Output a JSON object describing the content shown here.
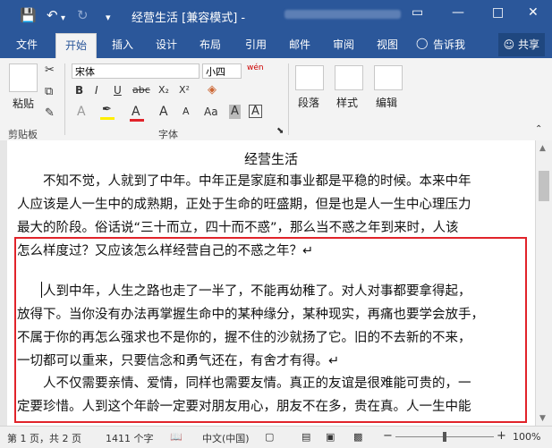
{
  "titlebar": {
    "save_icon": "save-icon",
    "undo_icon": "undo-icon",
    "redo_icon": "redo-icon",
    "title": "经营生活 [兼容模式] -",
    "minimize": "—",
    "restore": "□",
    "close": "✕"
  },
  "tabs": {
    "file": "文件",
    "home": "开始",
    "insert": "插入",
    "design": "设计",
    "layout": "布局",
    "references": "引用",
    "mailings": "邮件",
    "review": "审阅",
    "view": "视图",
    "tell_me": "告诉我",
    "share": "共享"
  },
  "ribbon": {
    "paste": "粘贴",
    "clipboard": "剪贴板",
    "font_name": "宋体",
    "font_size": "小四",
    "wen": "wén",
    "font_group": "字体",
    "bold": "B",
    "italic": "I",
    "underline": "U",
    "strike": "abc",
    "subscript": "X₂",
    "superscript": "X²",
    "font_a": "A",
    "grow_a": "A",
    "shrink_a": "A",
    "case_a": "Aa",
    "boxed_a": "A",
    "paragraph": "段落",
    "styles": "样式",
    "editing": "编辑"
  },
  "document": {
    "title": "经营生活",
    "lines": [
      "　　不知不觉，人就到了中年。中年正是家庭和事业都是平稳的时候。本来中年",
      "人应该是人一生中的成熟期，正处于生命的旺盛期，但是也是人一生中心理压力",
      "最大的阶段。俗话说“三十而立，四十而不惑”，那么当不惑之年到来时，人该",
      "怎么样度过？又应该怎么样经营自己的不惑之年？↵",
      "　　人到中年，人生之路也走了一半了，不能再幼稚了。对人对事都要拿得起，",
      "放得下。当你没有办法再掌握生命中的某种缘分，某种现实，再痛也要学会放手，",
      "不属于你的再怎么强求也不是你的，握不住的沙就扬了它。旧的不去新的不来，",
      "一切都可以重来，只要信念和勇气还在，有舍才有得。↵",
      "　　人不仅需要亲情、爱情，同样也需要友情。真正的友谊是很难能可贵的，一",
      "定要珍惜。人到这个年龄一定要对朋友用心，朋友不在多，贵在真。人一生中能"
    ]
  },
  "status": {
    "page": "第 1 页，共 2 页",
    "words": "1411 个字",
    "language": "中文(中国)",
    "zoom_minus": "−",
    "zoom_plus": "+",
    "zoom": "100%"
  }
}
